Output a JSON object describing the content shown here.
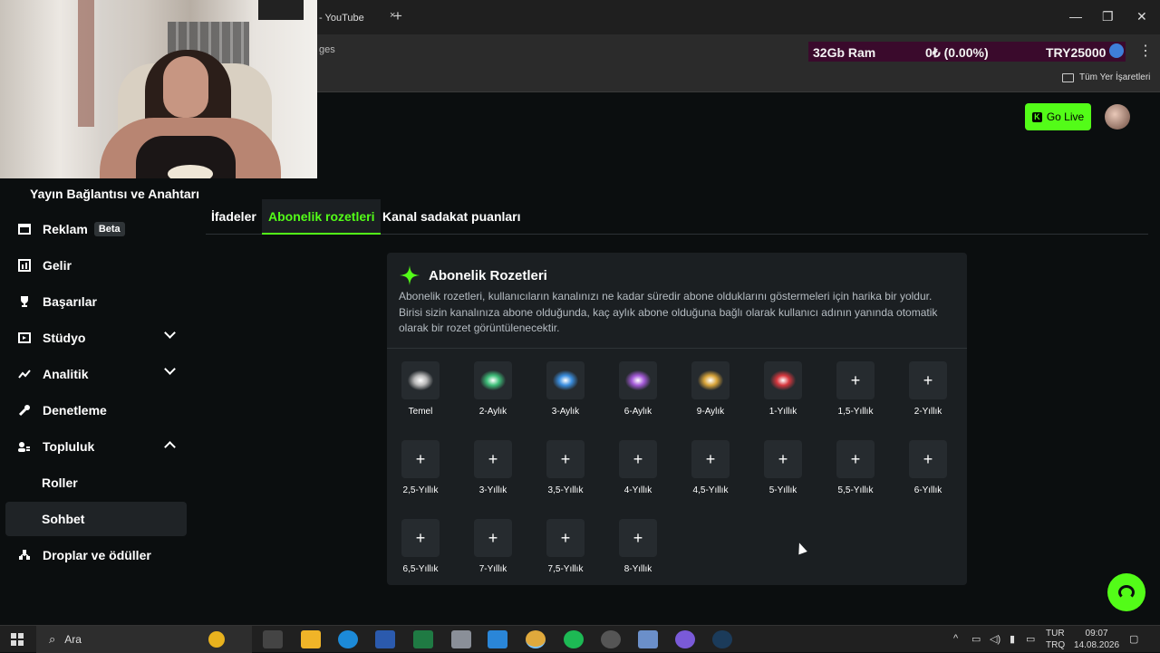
{
  "browser": {
    "tab_title": "- YouTube",
    "tab_close": "×",
    "new_tab": "+",
    "address_fragment": "ges",
    "bookmarks_all": "Tüm Yer İşaretleri",
    "window_controls": [
      "—",
      "❐",
      "✕"
    ],
    "menu": "⋮"
  },
  "overlay": {
    "ram": "32Gb Ram",
    "change": "0₺ (0.00%)",
    "balance": "TRY25000"
  },
  "header": {
    "go_live": "Go Live",
    "logo_letter": "K"
  },
  "sidebar": {
    "header": "Yayın Bağlantısı ve Anahtarı",
    "items": [
      {
        "label": "Reklam",
        "badge": "Beta",
        "icon": "tv-icon"
      },
      {
        "label": "Gelir",
        "icon": "revenue-icon"
      },
      {
        "label": "Başarılar",
        "icon": "trophy-icon"
      },
      {
        "label": "Stüdyo",
        "icon": "studio-icon",
        "expand": "down"
      },
      {
        "label": "Analitik",
        "icon": "chart-icon",
        "expand": "down"
      },
      {
        "label": "Denetleme",
        "icon": "wrench-icon"
      },
      {
        "label": "Topluluk",
        "icon": "community-icon",
        "expand": "up"
      },
      {
        "label": "Roller"
      },
      {
        "label": "Sohbet"
      },
      {
        "label": "Droplar ve ödüller",
        "icon": "drops-icon"
      }
    ]
  },
  "tabs": [
    "İfadeler",
    "Abonelik rozetleri",
    "Kanal sadakat puanları"
  ],
  "card": {
    "title": "Abonelik Rozetleri",
    "description": "Abonelik rozetleri, kullanıcıların kanalınızı ne kadar süredir abone olduklarını göstermeleri için harika bir yoldur. Birisi sizin kanalınıza abone olduğunda, kaç aylık abone olduğuna bağlı olarak kullanıcı adının yanında otomatik olarak bir rozet görüntülenecektir.",
    "add_symbol": "+",
    "badges": [
      {
        "label": "Temel",
        "color": "#b8b8b8"
      },
      {
        "label": "2-Aylık",
        "color": "#3fbf7a"
      },
      {
        "label": "3-Aylık",
        "color": "#3b8fe0"
      },
      {
        "label": "6-Aylık",
        "color": "#a45ad8"
      },
      {
        "label": "9-Aylık",
        "color": "#d9a53a"
      },
      {
        "label": "1-Yıllık",
        "color": "#d8383f"
      },
      {
        "label": "1,5-Yıllık"
      },
      {
        "label": "2-Yıllık"
      },
      {
        "label": "2,5-Yıllık"
      },
      {
        "label": "3-Yıllık"
      },
      {
        "label": "3,5-Yıllık"
      },
      {
        "label": "4-Yıllık"
      },
      {
        "label": "4,5-Yıllık"
      },
      {
        "label": "5-Yıllık"
      },
      {
        "label": "5,5-Yıllık"
      },
      {
        "label": "6-Yıllık"
      },
      {
        "label": "6,5-Yıllık"
      },
      {
        "label": "7-Yıllık"
      },
      {
        "label": "7,5-Yıllık"
      },
      {
        "label": "8-Yıllık"
      }
    ]
  },
  "taskbar": {
    "search": "Ara",
    "lang_line1": "TUR",
    "lang_line2": "TRQ",
    "time": "09:07",
    "date": "14.08.2026",
    "tray_up": "^"
  },
  "colors": {
    "accent": "#53fc18",
    "card_bg": "#1b1f22",
    "overlay_bg": "#3a0a2c"
  }
}
